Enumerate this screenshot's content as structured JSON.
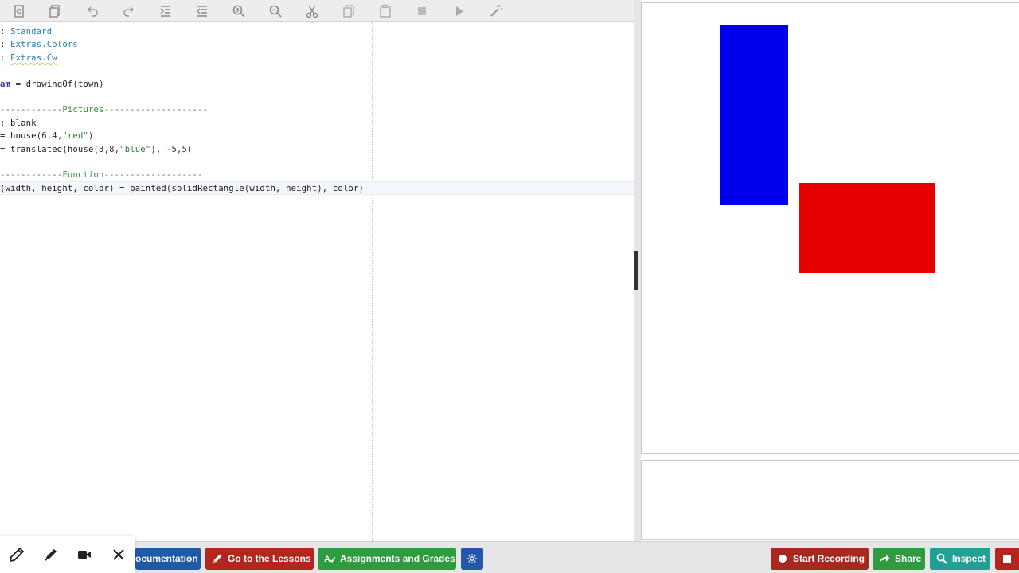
{
  "toolbar": {
    "buttons": [
      "new-file",
      "copy-file",
      "undo",
      "redo",
      "indent",
      "outdent",
      "zoom-in",
      "zoom-out",
      "cut",
      "copy",
      "paste",
      "stop",
      "run",
      "magic-wand"
    ]
  },
  "editor": {
    "lines": [
      {
        "tokens": [
          {
            "t": ": ",
            "c": "c-kw"
          },
          {
            "t": "Standard",
            "c": "c-mod"
          }
        ]
      },
      {
        "tokens": [
          {
            "t": ": ",
            "c": "c-kw"
          },
          {
            "t": "Extras.Colors",
            "c": "c-mod"
          }
        ]
      },
      {
        "tokens": [
          {
            "t": ": ",
            "c": "c-kw"
          },
          {
            "t": "Extras.Cw",
            "c": "c-mod-warn"
          }
        ]
      },
      {
        "tokens": []
      },
      {
        "tokens": [
          {
            "t": "am",
            "c": "c-def"
          },
          {
            "t": " = drawingOf",
            "c": "c-kw"
          },
          {
            "t": "(",
            "c": "c-paren"
          },
          {
            "t": "town",
            "c": "c-kw"
          },
          {
            "t": ")",
            "c": "c-paren"
          }
        ]
      },
      {
        "tokens": []
      },
      {
        "tokens": [
          {
            "t": "------------Pictures--------------------",
            "c": "c-comment"
          }
        ]
      },
      {
        "tokens": [
          {
            "t": ": blank",
            "c": "c-kw"
          }
        ]
      },
      {
        "tokens": [
          {
            "t": "= house",
            "c": "c-kw"
          },
          {
            "t": "(",
            "c": "c-paren"
          },
          {
            "t": "6,4,",
            "c": "c-num"
          },
          {
            "t": "\"red\"",
            "c": "c-str"
          },
          {
            "t": ")",
            "c": "c-paren"
          }
        ]
      },
      {
        "tokens": [
          {
            "t": "= translated",
            "c": "c-kw"
          },
          {
            "t": "(",
            "c": "c-paren"
          },
          {
            "t": "house",
            "c": "c-kw"
          },
          {
            "t": "(",
            "c": "c-paren"
          },
          {
            "t": "3,8,",
            "c": "c-num"
          },
          {
            "t": "\"blue\"",
            "c": "c-str"
          },
          {
            "t": "), -5,5)",
            "c": "c-paren"
          }
        ]
      },
      {
        "tokens": []
      },
      {
        "tokens": [
          {
            "t": "------------Function-------------------",
            "c": "c-comment"
          }
        ]
      },
      {
        "tokens": [
          {
            "t": "(",
            "c": "c-paren"
          },
          {
            "t": "width, height, color",
            "c": "c-kw"
          },
          {
            "t": ")",
            "c": "c-paren"
          },
          {
            "t": " = painted",
            "c": "c-kw"
          },
          {
            "t": "(",
            "c": "c-paren"
          },
          {
            "t": "solidRectangle",
            "c": "c-kw"
          },
          {
            "t": "(",
            "c": "c-paren"
          },
          {
            "t": "width, height",
            "c": "c-kw"
          },
          {
            "t": "), color",
            "c": "c-kw"
          },
          {
            "t": ")",
            "c": "c-paren"
          }
        ]
      }
    ]
  },
  "output": {
    "shapes": [
      {
        "name": "blue-rectangle",
        "color": "#0000ee"
      },
      {
        "name": "red-rectangle",
        "color": "#e60000"
      }
    ]
  },
  "bottom_bar": {
    "documentation_label": "ocumentation",
    "lessons_label": "Go to the Lessons",
    "assignments_label": "Assignments and Grades",
    "record_label": "Start Recording",
    "share_label": "Share",
    "inspect_label": "Inspect"
  },
  "colors": {
    "doc_blue": "#1f5aa6",
    "lessons_red": "#b3261e",
    "assign_green": "#2e9b3e",
    "settings_blue": "#2457a8",
    "record_red": "#a8281f",
    "share_green": "#2e9b3e",
    "inspect_teal": "#22a095",
    "stop_red": "#b3261e"
  }
}
